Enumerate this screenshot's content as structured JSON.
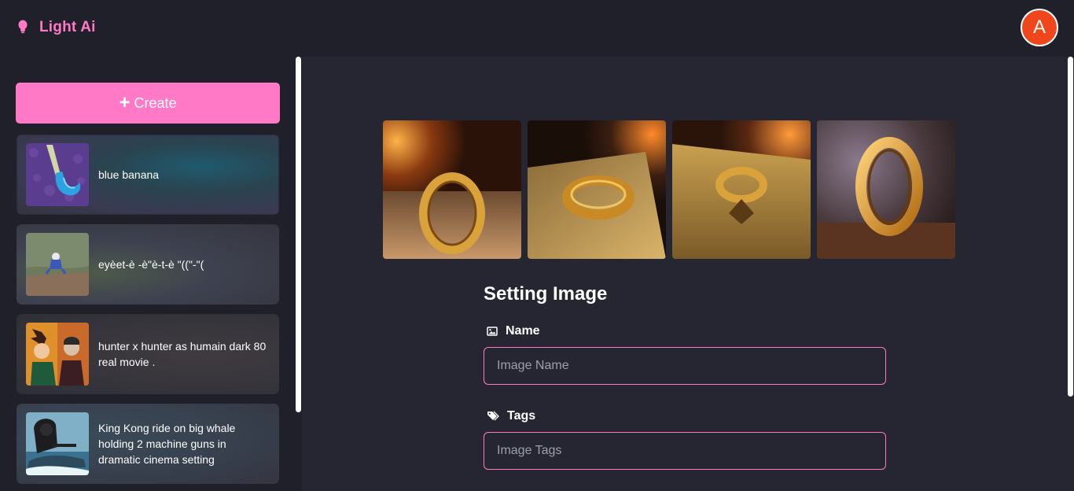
{
  "app": {
    "name": "Light Ai",
    "avatar_letter": "A"
  },
  "colors": {
    "accent": "#ff79c6",
    "avatar": "#f0461b",
    "header_bg": "#1f2029",
    "main_bg": "#252632"
  },
  "sidebar": {
    "create_label": "Create",
    "items": [
      {
        "label": "blue banana"
      },
      {
        "label": "eyèet-è -è\"è-t-è \"((\"-\"("
      },
      {
        "label": "hunter x hunter as humain dark 80 real movie ."
      },
      {
        "label": "King Kong ride on big whale holding 2 machine guns in dramatic cinema setting"
      }
    ]
  },
  "main": {
    "form": {
      "title": "Setting Image",
      "name_label": "Name",
      "name_placeholder": "Image Name",
      "tags_label": "Tags",
      "tags_placeholder": "Image Tags"
    }
  }
}
